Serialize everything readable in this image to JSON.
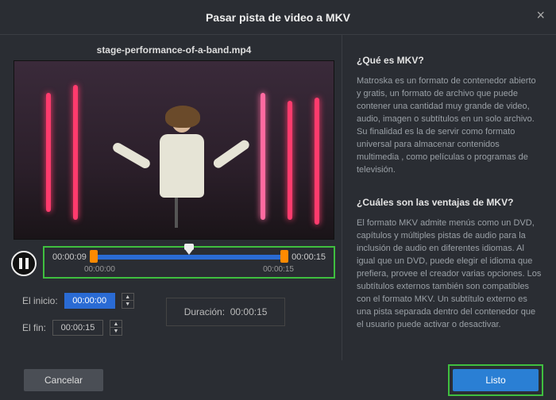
{
  "header": {
    "title": "Pasar pista de video a MKV"
  },
  "file": {
    "name": "stage-performance-of-a-band.mp4"
  },
  "player": {
    "current_time": "00:00:09",
    "total_time": "00:00:15",
    "range_start": "00:00:00",
    "range_end": "00:00:15"
  },
  "inputs": {
    "start_label": "El inicio:",
    "start_value": "00:00:00",
    "end_label": "El fin:",
    "end_value": "00:00:15",
    "duration_label": "Duración:",
    "duration_value": "00:00:15"
  },
  "info": {
    "q1_title": "¿Qué es MKV?",
    "q1_body": "Matroska es un formato de contenedor abierto y gratis, un formato de archivo que puede contener una cantidad muy grande de video, audio, imagen o subtítulos en un solo archivo. Su finalidad es la de servir como formato universal para almacenar contenidos multimedia , como películas o programas de televisión.",
    "q2_title": "¿Cuáles son las ventajas de MKV?",
    "q2_body": "El formato MKV admite menús como un DVD, capítulos y múltiples pistas de audio para la inclusión de audio en diferentes idiomas. Al igual que un DVD, puede elegir el idioma que prefiera, provee el creador varias opciones. Los subtítulos externos también son compatibles con el formato MKV. Un subtítulo externo es una pista separada dentro del contenedor que el usuario puede activar o desactivar."
  },
  "buttons": {
    "cancel": "Cancelar",
    "done": "Listo"
  }
}
